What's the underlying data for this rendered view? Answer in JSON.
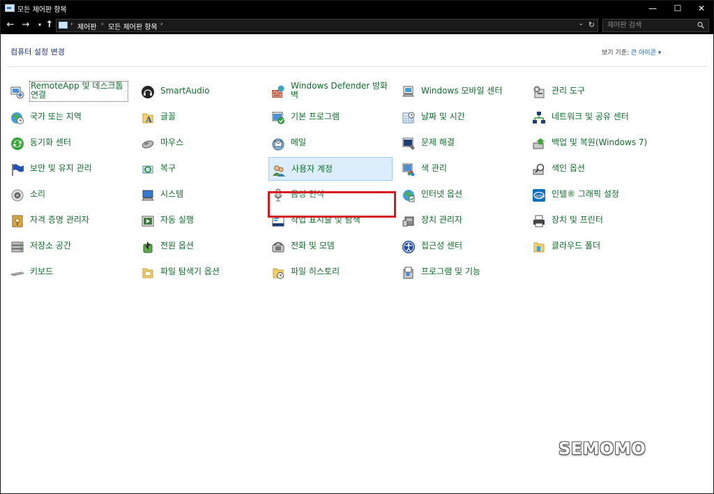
{
  "window": {
    "title": "모든 제어판 항목",
    "controls": {
      "minimize": "—",
      "maximize": "☐",
      "close": "✕"
    }
  },
  "address_bar": {
    "breadcrumbs": [
      "제어판",
      "모든 제어판 항목"
    ],
    "search_placeholder": "제어판 검색"
  },
  "header": {
    "title": "컴퓨터 설정 변경",
    "view_by_label": "보기 기준:",
    "view_by_value": "큰 아이콘 ▾"
  },
  "columns": [
    [
      {
        "label": "RemoteApp 및 데스크톱 연결",
        "icon": "remoteapp-icon"
      },
      {
        "label": "국가 또는 지역",
        "icon": "globe-clock-icon"
      },
      {
        "label": "동기화 센터",
        "icon": "sync-icon"
      },
      {
        "label": "보안 및 유지 관리",
        "icon": "flag-icon"
      },
      {
        "label": "소리",
        "icon": "speaker-icon"
      },
      {
        "label": "자격 증명 관리자",
        "icon": "credential-vault-icon"
      },
      {
        "label": "저장소 공간",
        "icon": "storage-spaces-icon"
      },
      {
        "label": "키보드",
        "icon": "keyboard-icon"
      }
    ],
    [
      {
        "label": "SmartAudio",
        "icon": "headphones-icon"
      },
      {
        "label": "글꼴",
        "icon": "font-folder-icon"
      },
      {
        "label": "마우스",
        "icon": "mouse-icon"
      },
      {
        "label": "복구",
        "icon": "recovery-icon"
      },
      {
        "label": "시스템",
        "icon": "system-icon"
      },
      {
        "label": "자동 실행",
        "icon": "autoplay-icon"
      },
      {
        "label": "전원 옵션",
        "icon": "power-options-icon"
      },
      {
        "label": "파일 탐색기 옵션",
        "icon": "folder-options-icon"
      }
    ],
    [
      {
        "label": "Windows Defender 방화벽",
        "icon": "firewall-icon"
      },
      {
        "label": "기본 프로그램",
        "icon": "default-programs-icon"
      },
      {
        "label": "메일",
        "icon": "mail-icon"
      },
      {
        "label": "사용자 계정",
        "icon": "user-accounts-icon"
      },
      {
        "label": "음성 인식",
        "icon": "microphone-icon"
      },
      {
        "label": "작업 표시줄 및 탐색",
        "icon": "taskbar-icon"
      },
      {
        "label": "전화 및 모뎀",
        "icon": "phone-modem-icon"
      },
      {
        "label": "파일 히스토리",
        "icon": "file-history-icon"
      }
    ],
    [
      {
        "label": "Windows 모바일 센터",
        "icon": "mobility-center-icon"
      },
      {
        "label": "날짜 및 시간",
        "icon": "calendar-clock-icon"
      },
      {
        "label": "문제 해결",
        "icon": "troubleshooting-icon"
      },
      {
        "label": "색 관리",
        "icon": "color-management-icon"
      },
      {
        "label": "인터넷 옵션",
        "icon": "internet-options-icon"
      },
      {
        "label": "장치 관리자",
        "icon": "device-manager-icon"
      },
      {
        "label": "접근성 센터",
        "icon": "ease-of-access-icon"
      },
      {
        "label": "프로그램 및 기능",
        "icon": "programs-features-icon"
      }
    ],
    [
      {
        "label": "관리 도구",
        "icon": "admin-tools-icon"
      },
      {
        "label": "네트워크 및 공유 센터",
        "icon": "network-icon"
      },
      {
        "label": "백업 및 복원(Windows 7)",
        "icon": "backup-icon"
      },
      {
        "label": "색인 옵션",
        "icon": "indexing-icon"
      },
      {
        "label": "인텔® 그래픽 설정",
        "icon": "intel-graphics-icon"
      },
      {
        "label": "장치 및 프린터",
        "icon": "printer-icon"
      },
      {
        "label": "클라우드 폴더",
        "icon": "cloud-folder-icon"
      }
    ]
  ],
  "watermark": "SEMOMO"
}
